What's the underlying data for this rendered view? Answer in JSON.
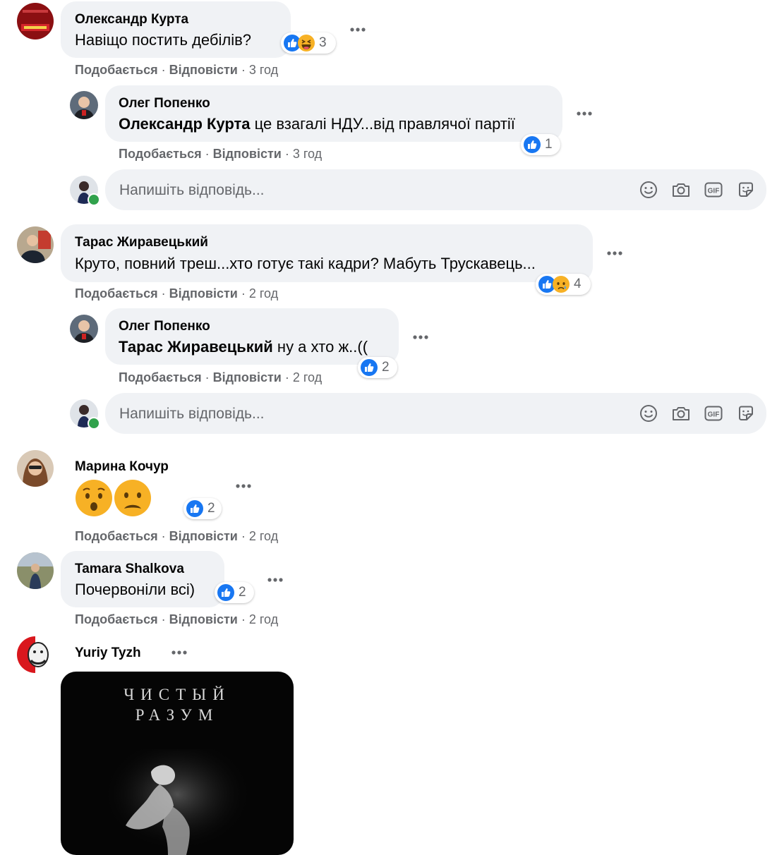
{
  "comments": [
    {
      "author": "Олександр Курта",
      "text": "Навіщо постить дебілів?",
      "reaction_count": "3",
      "reactions": [
        "like-icon",
        "haha-icon"
      ],
      "like": "Подобається",
      "reply": "Відповісти",
      "time": "3 год",
      "replies": [
        {
          "author": "Олег Попенко",
          "mention": "Олександр Курта",
          "text": " це взагалі НДУ...від правлячої партії",
          "reaction_count": "1",
          "reactions": [
            "like-icon"
          ],
          "like": "Подобається",
          "reply": "Відповісти",
          "time": "3 год"
        }
      ]
    },
    {
      "author": "Тарас Жиравецький",
      "text": "Круто, повний треш...хто готує такі кадри? Мабуть Трускавець...",
      "reaction_count": "4",
      "reactions": [
        "like-icon",
        "sad-icon"
      ],
      "like": "Подобається",
      "reply": "Відповісти",
      "time": "2 год",
      "replies": [
        {
          "author": "Олег Попенко",
          "mention": "Тарас Жиравецький",
          "text": " ну а хто ж..((",
          "reaction_count": "2",
          "reactions": [
            "like-icon"
          ],
          "like": "Подобається",
          "reply": "Відповісти",
          "time": "2 год"
        }
      ]
    },
    {
      "author": "Марина Кочур",
      "text": "",
      "emojis": [
        "hushed-face-emoji",
        "frowning-face-emoji"
      ],
      "reaction_count": "2",
      "reactions": [
        "like-icon"
      ],
      "like": "Подобається",
      "reply": "Відповісти",
      "time": "2 год"
    },
    {
      "author": "Tamara Shalkova",
      "text": "Почервоніли всі)",
      "reaction_count": "2",
      "reactions": [
        "like-icon"
      ],
      "like": "Подобається",
      "reply": "Відповісти",
      "time": "2 год"
    },
    {
      "author": "Yuriy Tyzh",
      "image_title_line1": "ЧИСТЫЙ",
      "image_title_line2": "РАЗУМ"
    }
  ],
  "reply_box": {
    "placeholder": "Напишіть відповідь...",
    "tools": [
      "smile-icon",
      "camera-icon",
      "gif-icon",
      "sticker-icon"
    ]
  },
  "separator": " · ",
  "colors": {
    "bubble": "#f0f2f5",
    "meta_text": "#65676b",
    "like_blue": "#1877f2",
    "online_green": "#31a24c"
  }
}
